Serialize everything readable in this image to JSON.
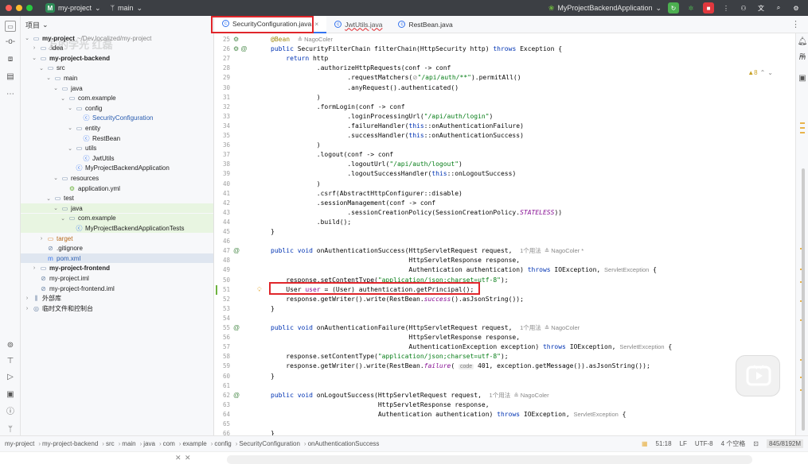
{
  "titlebar": {
    "project_badge": "M",
    "project": "my-project",
    "branch": "main",
    "run_config": "MyProjectBackendApplication"
  },
  "project_panel": {
    "header": "项目",
    "watermark": "万的学光 红磊",
    "tree": [
      {
        "indent": 0,
        "arrow": "⌄",
        "icon": "folder",
        "label": "my-project",
        "extra": "~/Dev.localized/my-project",
        "bold": true
      },
      {
        "indent": 1,
        "arrow": "›",
        "icon": "folder",
        "label": ".idea"
      },
      {
        "indent": 1,
        "arrow": "⌄",
        "icon": "folder",
        "label": "my-project-backend",
        "bold": true
      },
      {
        "indent": 2,
        "arrow": "⌄",
        "icon": "folder",
        "label": "src"
      },
      {
        "indent": 3,
        "arrow": "⌄",
        "icon": "folder",
        "label": "main"
      },
      {
        "indent": 4,
        "arrow": "⌄",
        "icon": "folder",
        "label": "java"
      },
      {
        "indent": 5,
        "arrow": "⌄",
        "icon": "package",
        "label": "com.example"
      },
      {
        "indent": 6,
        "arrow": "⌄",
        "icon": "package",
        "label": "config"
      },
      {
        "indent": 7,
        "arrow": "",
        "icon": "class",
        "label": "SecurityConfiguration",
        "blue": true
      },
      {
        "indent": 6,
        "arrow": "⌄",
        "icon": "package",
        "label": "entity"
      },
      {
        "indent": 7,
        "arrow": "",
        "icon": "class",
        "label": "RestBean"
      },
      {
        "indent": 6,
        "arrow": "⌄",
        "icon": "package",
        "label": "utils"
      },
      {
        "indent": 7,
        "arrow": "",
        "icon": "class",
        "label": "JwtUtils"
      },
      {
        "indent": 6,
        "arrow": "",
        "icon": "class",
        "label": "MyProjectBackendApplication"
      },
      {
        "indent": 4,
        "arrow": "⌄",
        "icon": "folder",
        "label": "resources"
      },
      {
        "indent": 5,
        "arrow": "",
        "icon": "yml",
        "label": "application.yml"
      },
      {
        "indent": 3,
        "arrow": "⌄",
        "icon": "folder",
        "label": "test"
      },
      {
        "indent": 4,
        "arrow": "⌄",
        "icon": "folder",
        "label": "java",
        "green": true
      },
      {
        "indent": 5,
        "arrow": "⌄",
        "icon": "package",
        "label": "com.example",
        "green": true
      },
      {
        "indent": 6,
        "arrow": "",
        "icon": "class",
        "label": "MyProjectBackendApplicationTests",
        "green": true
      },
      {
        "indent": 2,
        "arrow": "›",
        "icon": "folder",
        "label": "target",
        "orange": true
      },
      {
        "indent": 2,
        "arrow": "",
        "icon": "file",
        "label": ".gitignore"
      },
      {
        "indent": 2,
        "arrow": "",
        "icon": "maven",
        "label": "pom.xml",
        "selected": true,
        "blue": true
      },
      {
        "indent": 1,
        "arrow": "›",
        "icon": "folder",
        "label": "my-project-frontend",
        "bold": true
      },
      {
        "indent": 1,
        "arrow": "",
        "icon": "file",
        "label": "my-project.iml"
      },
      {
        "indent": 1,
        "arrow": "",
        "icon": "file",
        "label": "my-project-frontend.iml"
      },
      {
        "indent": 0,
        "arrow": "›",
        "icon": "lib",
        "label": "外部库"
      },
      {
        "indent": 0,
        "arrow": "›",
        "icon": "scratch",
        "label": "临时文件和控制台"
      }
    ]
  },
  "tabs": [
    {
      "label": "SecurityConfiguration.java",
      "active": true
    },
    {
      "label": "JwtUtils.java",
      "active": false
    },
    {
      "label": "RestBean.java",
      "active": false
    }
  ],
  "inspection": "▲8",
  "lines": [
    {
      "n": "25",
      "html": "<span class='ann'>@Bean</span>  <span class='hint'>≗ NagoColer</span>"
    },
    {
      "n": "26",
      "html": "<span class='kw'>public</span> SecurityFilterChain filterChain(HttpSecurity http) <span class='kw'>throws</span> Exception {"
    },
    {
      "n": "27",
      "html": "    <span class='kw'>return</span> http"
    },
    {
      "n": "28",
      "html": "            .authorizeHttpRequests(conf -> conf"
    },
    {
      "n": "29",
      "html": "                    .requestMatchers(<span class='hint'>⊘</span><span class='str'>\"/api/auth/**\"</span>).permitAll()"
    },
    {
      "n": "30",
      "html": "                    .anyRequest().authenticated()"
    },
    {
      "n": "31",
      "html": "            )"
    },
    {
      "n": "32",
      "html": "            .formLogin(conf -> conf"
    },
    {
      "n": "33",
      "html": "                    .loginProcessingUrl(<span class='str'>\"/api/auth/login\"</span>)"
    },
    {
      "n": "34",
      "html": "                    .failureHandler(<span class='kw'>this</span>::onAuthenticationFailure)"
    },
    {
      "n": "35",
      "html": "                    .successHandler(<span class='kw'>this</span>::onAuthenticationSuccess)"
    },
    {
      "n": "36",
      "html": "            )"
    },
    {
      "n": "37",
      "html": "            .logout(conf -> conf"
    },
    {
      "n": "38",
      "html": "                    .logoutUrl(<span class='str'>\"/api/auth/logout\"</span>)"
    },
    {
      "n": "39",
      "html": "                    .logoutSuccessHandler(<span class='kw'>this</span>::onLogoutSuccess)"
    },
    {
      "n": "40",
      "html": "            )"
    },
    {
      "n": "41",
      "html": "            .csrf(AbstractHttpConfigurer::disable)"
    },
    {
      "n": "42",
      "html": "            .sessionManagement(conf -> conf"
    },
    {
      "n": "43",
      "html": "                    .sessionCreationPolicy(SessionCreationPolicy.<span class='it'>STATELESS</span>))"
    },
    {
      "n": "44",
      "html": "            .build();"
    },
    {
      "n": "45",
      "html": "}"
    },
    {
      "n": "46",
      "html": ""
    },
    {
      "n": "47",
      "html": "<span class='kw'>public void</span> onAuthenticationSuccess(HttpServletRequest request,  <span class='hint'>1个用法  ≗ NagoColer *</span>"
    },
    {
      "n": "48",
      "html": "                                    HttpServletResponse response,"
    },
    {
      "n": "49",
      "html": "                                    Authentication authentication) <span class='kw'>throws</span> IOException, <span class='hint'>ServletException</span> {"
    },
    {
      "n": "50",
      "html": "    response.setContentType(<span class='str'>\"application/json;charset=utf-8\"</span>);"
    },
    {
      "n": "51",
      "html": "    User <span class='param'>user</span> = (User) authentication.getPrincipal();"
    },
    {
      "n": "52",
      "html": "    response.getWriter().write(RestBean.<span class='it'>success</span>().asJsonString());"
    },
    {
      "n": "53",
      "html": "}"
    },
    {
      "n": "54",
      "html": ""
    },
    {
      "n": "55",
      "html": "<span class='kw'>public void</span> onAuthenticationFailure(HttpServletRequest request,  <span class='hint'>1个用法  ≗ NagoColer</span>"
    },
    {
      "n": "56",
      "html": "                                    HttpServletResponse response,"
    },
    {
      "n": "57",
      "html": "                                    AuthenticationException exception) <span class='kw'>throws</span> IOException, <span class='hint'>ServletException</span> {"
    },
    {
      "n": "58",
      "html": "    response.setContentType(<span class='str'>\"application/json;charset=utf-8\"</span>);"
    },
    {
      "n": "59",
      "html": "    response.getWriter().write(RestBean.<span class='it'>failure</span>( <span class='hintbox'>code</span> 401, exception.getMessage()).asJsonString());"
    },
    {
      "n": "60",
      "html": "}"
    },
    {
      "n": "61",
      "html": ""
    },
    {
      "n": "62",
      "html": "<span class='kw'>public void</span> onLogoutSuccess(HttpServletRequest request,  <span class='hint'>1个用法  ≗ NagoColer</span>"
    },
    {
      "n": "63",
      "html": "                            HttpServletResponse response,"
    },
    {
      "n": "64",
      "html": "                            Authentication authentication) <span class='kw'>throws</span> IOException, <span class='hint'>ServletException</span> {"
    },
    {
      "n": "65",
      "html": ""
    },
    {
      "n": "66",
      "html": "}"
    }
  ],
  "breadcrumb": [
    "my-project",
    "my-project-backend",
    "src",
    "main",
    "java",
    "com",
    "example",
    "config",
    "SecurityConfiguration",
    "onAuthenticationSuccess"
  ],
  "status": {
    "position": "51:18",
    "line_sep": "LF",
    "encoding": "UTF-8",
    "indent": "4 个空格",
    "memory": "845/8192M"
  },
  "colors": {
    "accent": "#3574f0",
    "highlight_box": "#e0262b",
    "brand": "#2e8b57"
  }
}
